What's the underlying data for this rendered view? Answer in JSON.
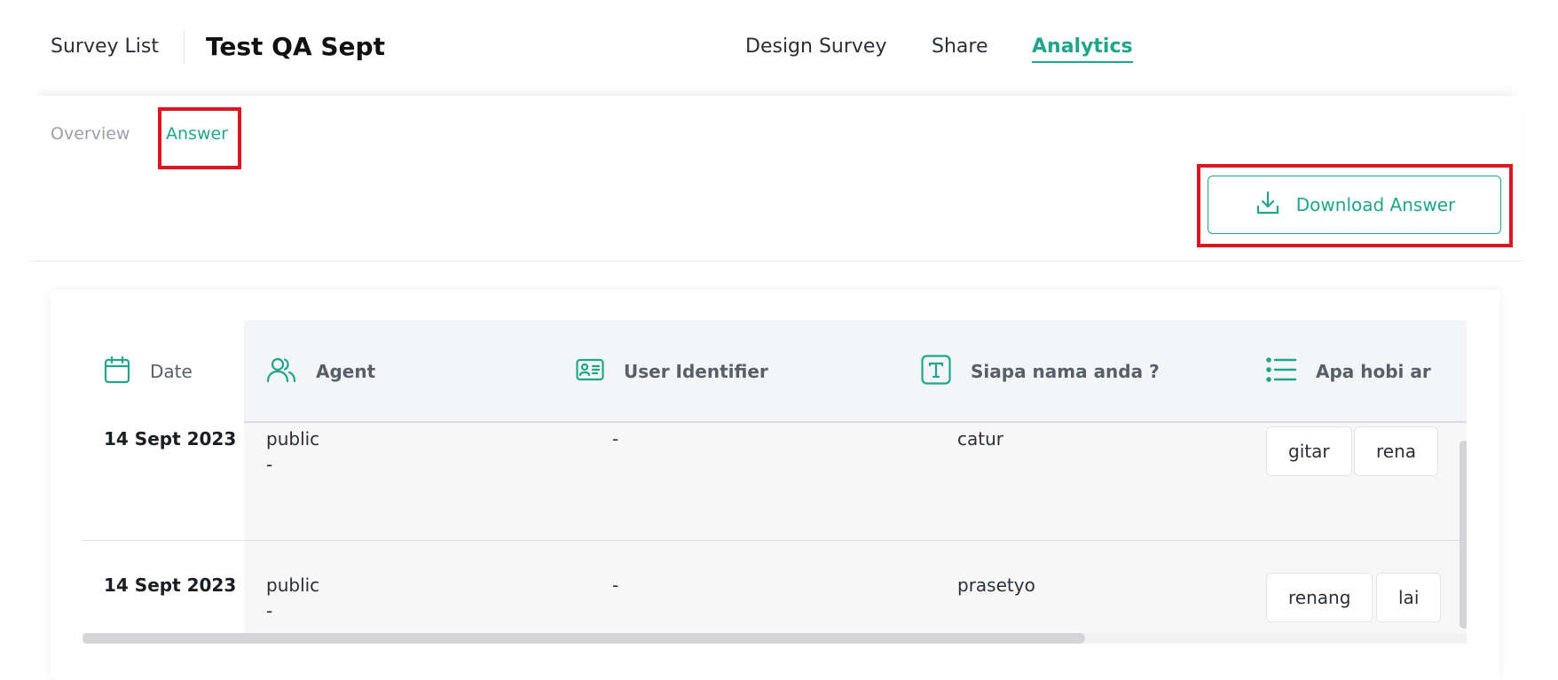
{
  "header": {
    "survey_list": "Survey List",
    "survey_title": "Test QA Sept",
    "tabs": [
      {
        "label": "Design Survey"
      },
      {
        "label": "Share"
      },
      {
        "label": "Analytics",
        "active": true
      }
    ]
  },
  "subtabs": [
    {
      "label": "Overview"
    },
    {
      "label": "Answer",
      "active": true
    }
  ],
  "download_button": {
    "label": "Download Answer",
    "icon": "download-icon"
  },
  "table": {
    "columns": [
      {
        "label": "Date",
        "icon": "calendar-icon"
      },
      {
        "label": "Agent",
        "icon": "users-icon"
      },
      {
        "label": "User Identifier",
        "icon": "id-card-icon"
      },
      {
        "label": "Siapa nama anda ?",
        "icon": "text-icon"
      },
      {
        "label": "Apa hobi ar",
        "icon": "list-icon"
      }
    ],
    "rows": [
      {
        "date": "14 Sept 2023",
        "agent": "public",
        "agent_sub": "-",
        "user_identifier": "-",
        "name": "catur",
        "hobbies": [
          "gitar",
          "rena"
        ]
      },
      {
        "date": "14 Sept 2023",
        "agent": "public",
        "agent_sub": "-",
        "user_identifier": "-",
        "name": "prasetyo",
        "hobbies": [
          "renang",
          "lai"
        ]
      }
    ]
  },
  "colors": {
    "accent": "#1fa68a",
    "highlight": "#e0141e"
  }
}
